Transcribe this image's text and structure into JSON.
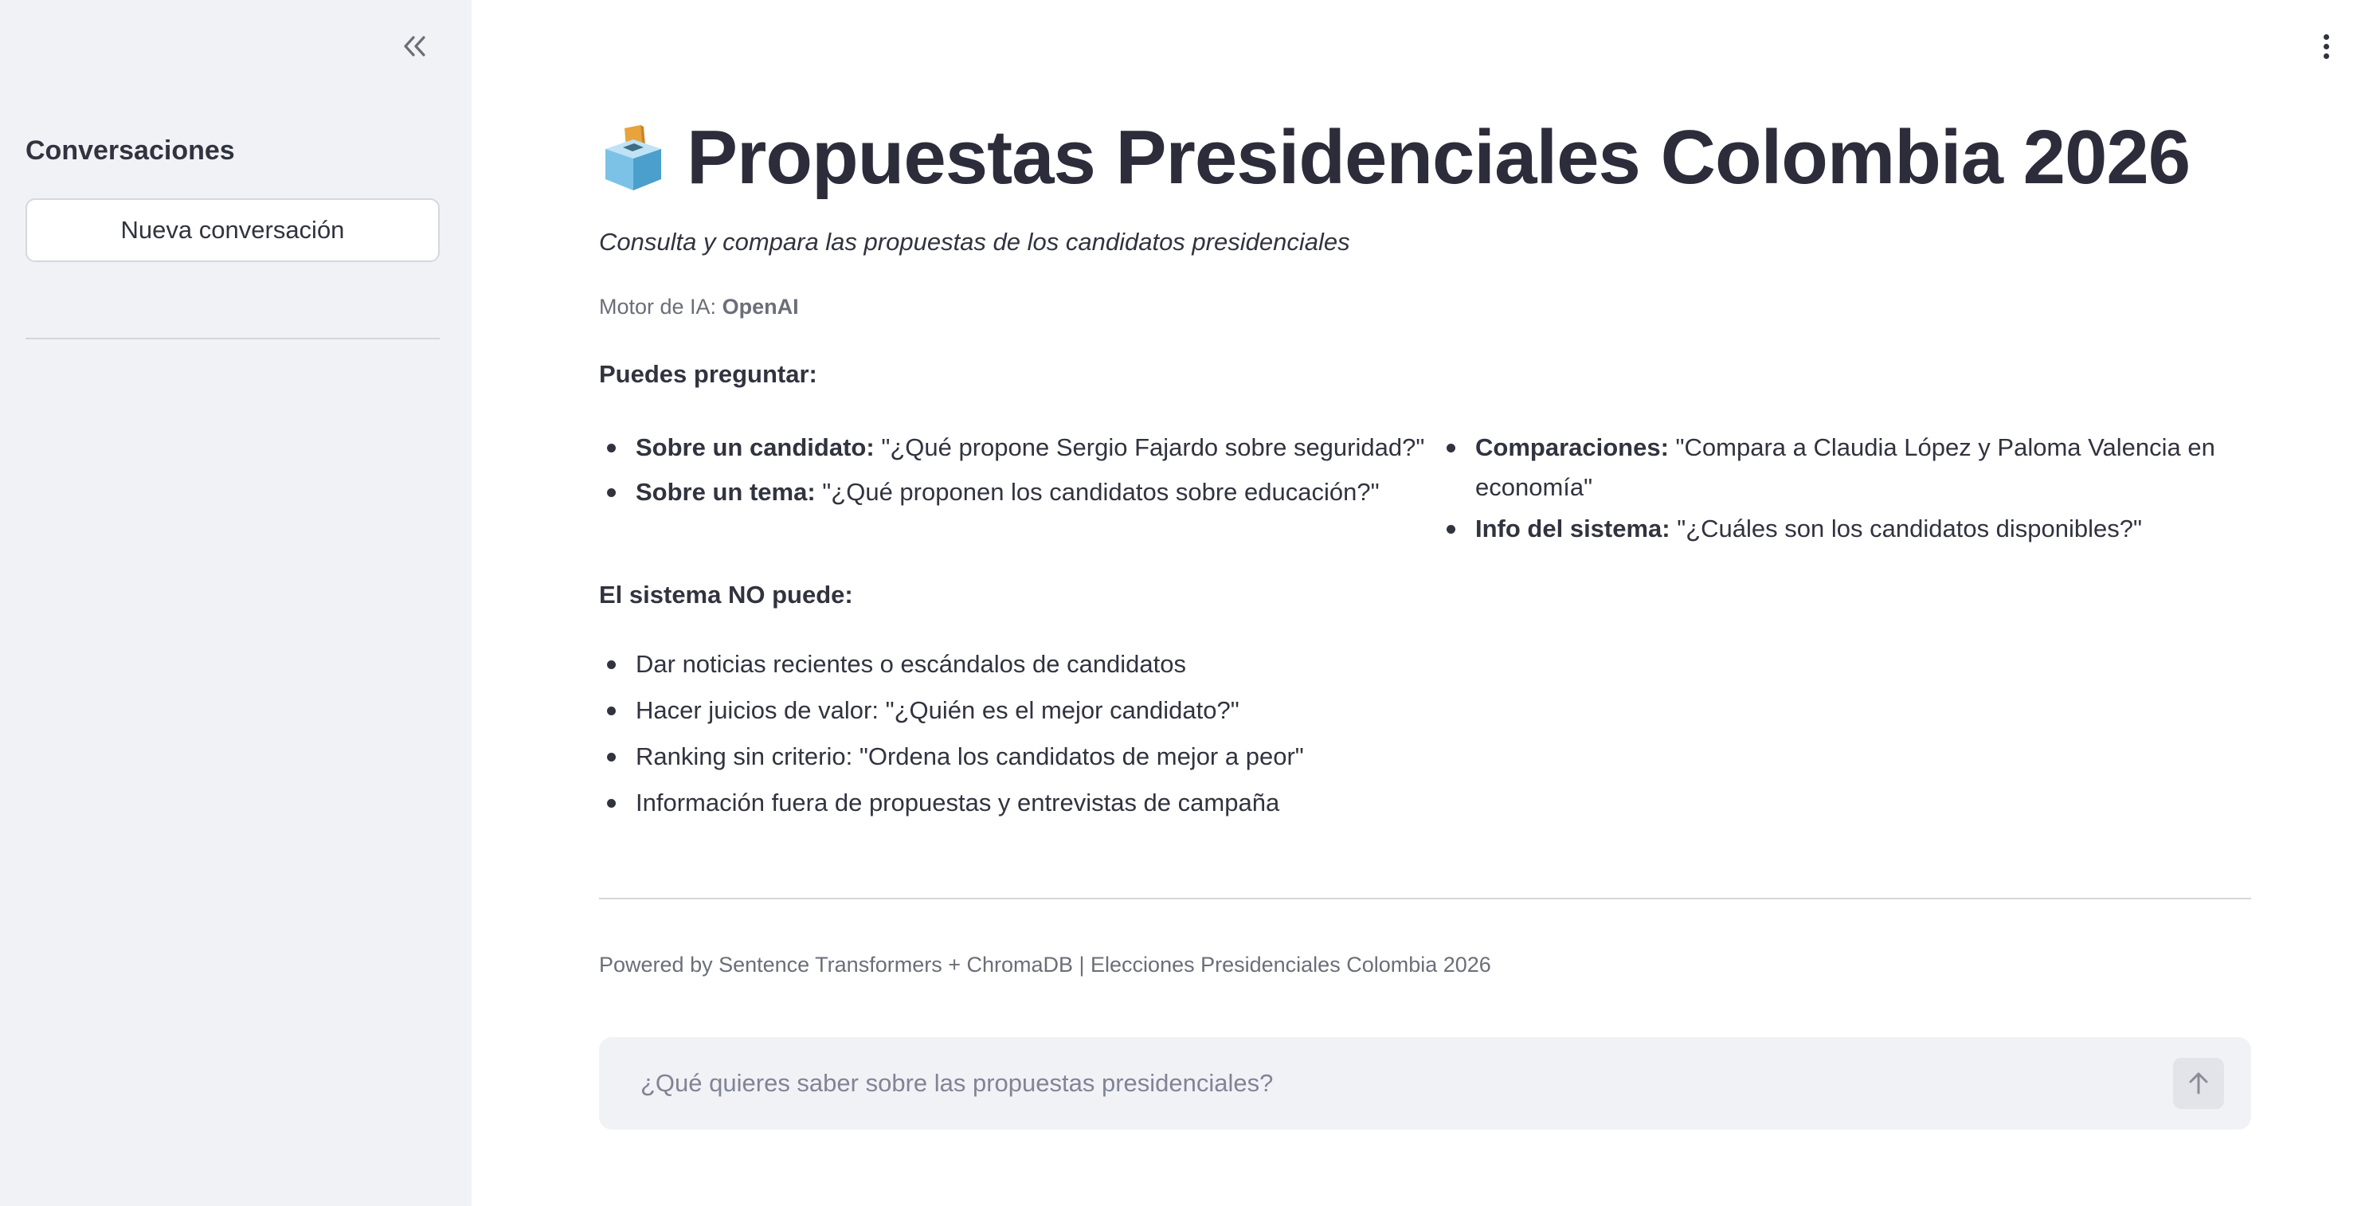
{
  "sidebar": {
    "collapse_icon": "double-chevron-left-icon",
    "title": "Conversaciones",
    "new_chat_label": "Nueva conversación"
  },
  "menu": {
    "icon": "vertical-ellipsis-icon"
  },
  "header": {
    "icon": "ballot-box-icon",
    "title": "Propuestas Presidenciales Colombia 2026",
    "subtitle": "Consulta y compara las propuestas de los candidatos presidenciales"
  },
  "engine": {
    "label": "Motor de IA:",
    "value": "OpenAI"
  },
  "can_ask": {
    "heading": "Puedes preguntar:",
    "left": [
      {
        "label": "Sobre un candidato:",
        "text": "\"¿Qué propone Sergio Fajardo sobre seguridad?\""
      },
      {
        "label": "Sobre un tema:",
        "text": "\"¿Qué proponen los candidatos sobre educación?\""
      }
    ],
    "right": [
      {
        "label": "Comparaciones:",
        "text": "\"Compara a Claudia López y Paloma Valencia en economía\""
      },
      {
        "label": "Info del sistema:",
        "text": "\"¿Cuáles son los candidatos disponibles?\""
      }
    ]
  },
  "cannot": {
    "heading": "El sistema NO puede:",
    "items": [
      "Dar noticias recientes o escándalos de candidatos",
      "Hacer juicios de valor: \"¿Quién es el mejor candidato?\"",
      "Ranking sin criterio: \"Ordena los candidatos de mejor a peor\"",
      "Información fuera de propuestas y entrevistas de campaña"
    ]
  },
  "footer": {
    "text": "Powered by Sentence Transformers + ChromaDB | Elecciones Presidenciales Colombia 2026"
  },
  "chat": {
    "placeholder": "¿Qué quieres saber sobre las propuestas presidenciales?",
    "value": "",
    "send_icon": "arrow-up-icon"
  },
  "colors": {
    "sidebar_bg": "#f0f2f6",
    "text": "#31333f",
    "muted": "#6b6e78"
  }
}
